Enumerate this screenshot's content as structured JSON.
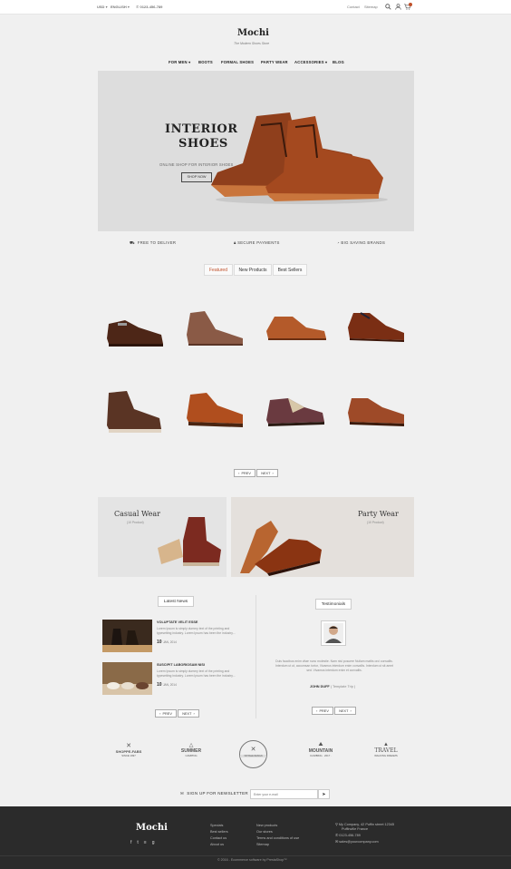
{
  "topbar": {
    "currency": "USD",
    "language": "ENGLISH",
    "phone": "0123-456-789",
    "contact": "Contact",
    "sitemap": "Sitemap"
  },
  "logo": {
    "name": "Mochi",
    "tagline": "The Modern Shoes Store"
  },
  "nav": {
    "items": [
      "FOR MEN",
      "BOOTS",
      "FORMAL SHOES",
      "PARTY WEAR",
      "ACCESSORIES",
      "BLOG"
    ]
  },
  "hero": {
    "title1": "INTERIOR",
    "title2": "SHOES",
    "subtitle": "ONLINE SHOP FOR INTERIOR SHOES",
    "button": "SHOP NOW"
  },
  "features": [
    "FREE TO DELIVER",
    "SECURE PAYMENTS",
    "BIG SAVING BRANDS"
  ],
  "tabs": [
    "Featured",
    "New Products",
    "Best Sellers"
  ],
  "pager": {
    "prev": "PREV",
    "next": "NEXT"
  },
  "banners": [
    {
      "title": "Casual Wear",
      "count": "(10 Product)"
    },
    {
      "title": "Party Wear",
      "count": "(10 Product)"
    }
  ],
  "news": {
    "label": "Latest News",
    "items": [
      {
        "title": "VOLUPTATE VELIT ESSE",
        "text": "Lorem Ipsum is simply dummy text of the printing and typesetting industry. Lorem Ipsum has been the industry...",
        "day": "10",
        "month": "JAN, 2014"
      },
      {
        "title": "SUSCIPIT LABORIOSAM NISI",
        "text": "Lorem Ipsum is simply dummy text of the printing and typesetting industry. Lorem Ipsum has been the industry...",
        "day": "10",
        "month": "JAN, 2014"
      }
    ]
  },
  "testimonials": {
    "label": "Testimonials",
    "text": "Duis faucibus enim vitae nunc molestie. Nam nisi posuere Nullam mattis orci convallis. Interdum ut ut, accumsan tortor, Vivamus interdum enim convallis. Interdum ut sit amet sed. Vivamus interdum enim et convallis.",
    "author": "JOHN DUFF",
    "role": "( Template Trip )"
  },
  "brands": [
    {
      "name": "SHOPPE-FABS",
      "sub": "SINCE 1997"
    },
    {
      "name": "SUMMER",
      "sub": "CAMPING"
    },
    {
      "name": "VINTAGE DESIGN",
      "sub": ""
    },
    {
      "name": "MOUNTAIN",
      "sub": "CLIMBING · 2017 ·"
    },
    {
      "name": "TRAVEL",
      "sub": "WALKING DREAMS"
    }
  ],
  "newsletter": {
    "label": "SIGN UP FOR NEWSLETTER",
    "placeholder": "Enter your e-mail"
  },
  "footer": {
    "col1": [
      "Specials",
      "Best sellers",
      "Contact us",
      "About us"
    ],
    "col2": [
      "New products",
      "Our stores",
      "Terms and conditions of use",
      "Sitemap"
    ],
    "address": [
      "My Company, 42 Puffin street 12345",
      "Puffinville France"
    ],
    "phone": "0123-456-789",
    "email": "sales@yourcompany.com",
    "copyright": "© 2016 - Ecommerce software by PrestaShop™"
  },
  "colors": {
    "accent": "#c0502a",
    "dark": "#2b2b2b"
  }
}
